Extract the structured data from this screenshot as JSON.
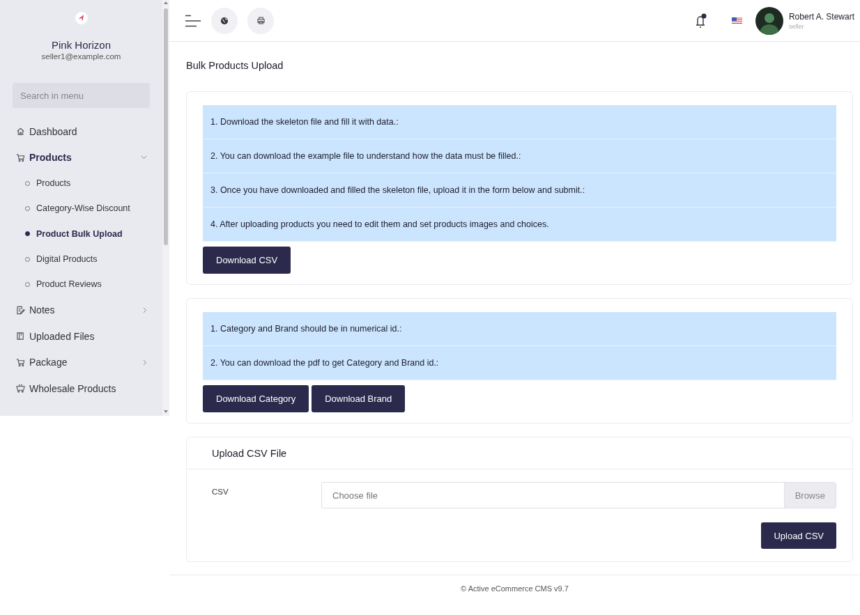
{
  "sidebar": {
    "brand": "Pink Horizon",
    "email": "seller1@example.com",
    "search": {
      "placeholder": "Search in menu"
    },
    "items": [
      {
        "kind": "link",
        "label": "Dashboard"
      },
      {
        "kind": "group",
        "label": "Products",
        "expanded": true,
        "children": [
          {
            "label": "Products",
            "selected": false
          },
          {
            "label": "Category-Wise Discount",
            "selected": false
          },
          {
            "label": "Product Bulk Upload",
            "selected": true
          },
          {
            "label": "Digital Products",
            "selected": false
          },
          {
            "label": "Product Reviews",
            "selected": false
          }
        ]
      },
      {
        "kind": "group",
        "label": "Notes",
        "expanded": false
      },
      {
        "kind": "link",
        "label": "Uploaded Files"
      },
      {
        "kind": "group",
        "label": "Package",
        "expanded": false
      },
      {
        "kind": "link",
        "label": "Wholesale Products"
      }
    ]
  },
  "topbar": {
    "notifications": {
      "unread": true
    },
    "user": {
      "name": "Robert A. Stewart",
      "role": "seller"
    }
  },
  "page_title": "Bulk Products Upload",
  "instruction_cards": [
    {
      "steps": [
        "1. Download the skeleton file and fill it with data.:",
        "2. You can download the example file to understand how the data must be filled.:",
        "3. Once you have downloaded and filled the skeleton file, upload it in the form below and submit.:",
        "4. After uploading products you need to edit them and set products images and choices."
      ],
      "buttons": [
        "Download CSV"
      ]
    },
    {
      "steps": [
        "1. Category and Brand should be in numerical id.:",
        "2. You can download the pdf to get Category and Brand id.:"
      ],
      "buttons": [
        "Download Category",
        "Download Brand"
      ]
    }
  ],
  "upload": {
    "title": "Upload CSV File",
    "field_label": "CSV",
    "file_placeholder": "Choose file",
    "browse_label": "Browse",
    "submit": "Upload CSV"
  },
  "footer": "© Active eCommerce CMS v9.7"
}
